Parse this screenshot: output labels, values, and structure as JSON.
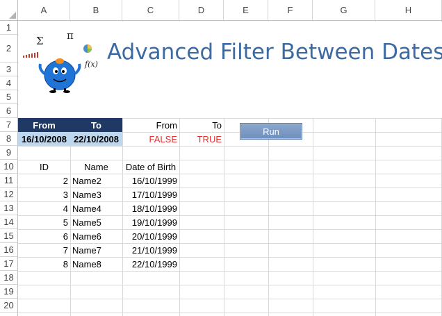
{
  "spreadsheet": {
    "columns": [
      "A",
      "B",
      "C",
      "D",
      "E",
      "F",
      "G",
      "H"
    ],
    "rows": [
      "1",
      "2",
      "3",
      "4",
      "5",
      "6",
      "7",
      "8",
      "9",
      "10",
      "11",
      "12",
      "13",
      "14",
      "15",
      "16",
      "17",
      "18",
      "19",
      "20"
    ]
  },
  "title": "Advanced Filter Between Dates",
  "logo": {
    "symbols": [
      "Σ",
      "π",
      "f(x)"
    ]
  },
  "criteria": {
    "from_header": "From",
    "to_header": "To",
    "from_value": "16/10/2008",
    "to_value": "22/10/2008",
    "from_label": "From",
    "to_label": "To",
    "from_result": "FALSE",
    "to_result": "TRUE"
  },
  "run_button": {
    "label": "Run"
  },
  "table": {
    "headers": [
      "ID",
      "Name",
      "Date of Birth"
    ],
    "rows": [
      {
        "id": "2",
        "name": "Name2",
        "dob": "16/10/1999"
      },
      {
        "id": "3",
        "name": "Name3",
        "dob": "17/10/1999"
      },
      {
        "id": "4",
        "name": "Name4",
        "dob": "18/10/1999"
      },
      {
        "id": "5",
        "name": "Name5",
        "dob": "19/10/1999"
      },
      {
        "id": "6",
        "name": "Name6",
        "dob": "20/10/1999"
      },
      {
        "id": "7",
        "name": "Name7",
        "dob": "21/10/1999"
      },
      {
        "id": "8",
        "name": "Name8",
        "dob": "22/10/1999"
      }
    ]
  },
  "colors": {
    "header_fill": "#1f3864",
    "date_fill": "#bdd7ee",
    "title": "#3d6aa0",
    "false_text": "#e03030",
    "true_text": "#e03030"
  }
}
